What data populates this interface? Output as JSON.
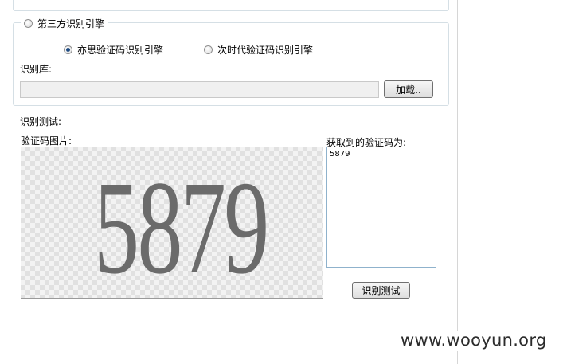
{
  "engine_group": {
    "third_party_label": "第三方识别引擎",
    "option_yisi": "亦思验证码识别引擎",
    "option_nextgen": "次时代验证码识别引擎",
    "selected_option": "亦思验证码识别引擎",
    "library_label": "识别库:",
    "library_path": "",
    "load_button": "加载.."
  },
  "test_section": {
    "title": "识别测试:",
    "captcha_label": "验证码图片:",
    "captcha_image_text": "5879",
    "result_label": "获取到的验证码为:",
    "result_value": "5879",
    "test_button": "识别测试"
  },
  "watermark": "www.wooyun.org"
}
